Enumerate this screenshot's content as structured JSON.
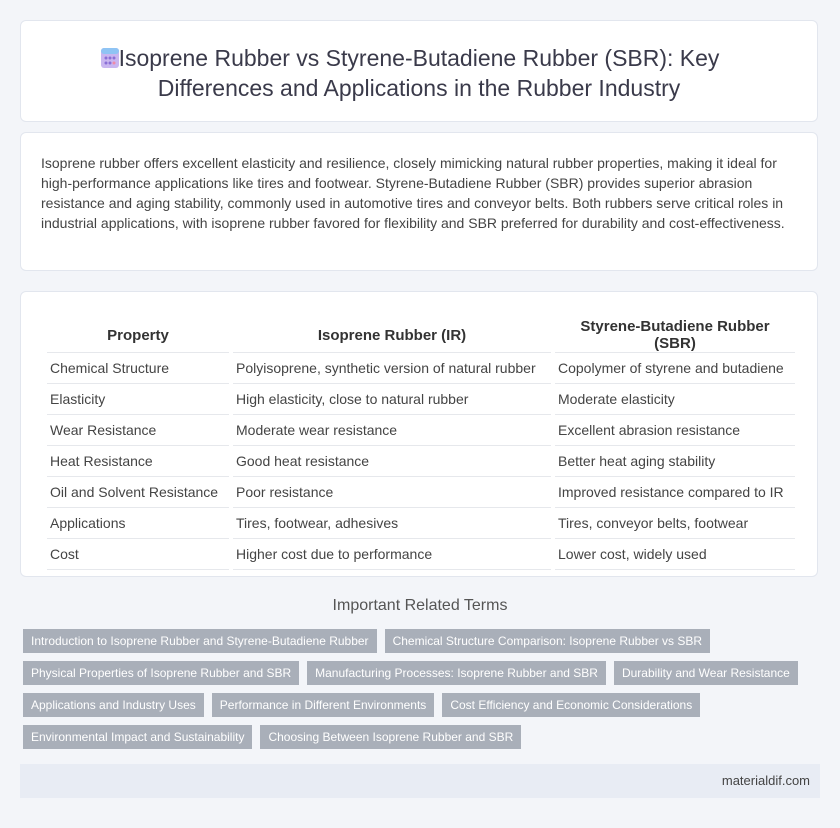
{
  "header": {
    "title": "Isoprene Rubber vs Styrene-Butadiene Rubber (SBR): Key Differences and Applications in the Rubber Industry",
    "icon": "calculator-icon"
  },
  "intro": "Isoprene rubber offers excellent elasticity and resilience, closely mimicking natural rubber properties, making it ideal for high-performance applications like tires and footwear. Styrene-Butadiene Rubber (SBR) provides superior abrasion resistance and aging stability, commonly used in automotive tires and conveyor belts. Both rubbers serve critical roles in industrial applications, with isoprene rubber favored for flexibility and SBR preferred for durability and cost-effectiveness.",
  "table": {
    "headers": [
      "Property",
      "Isoprene Rubber (IR)",
      "Styrene-Butadiene Rubber (SBR)"
    ],
    "rows": [
      [
        "Chemical Structure",
        "Polyisoprene, synthetic version of natural rubber",
        "Copolymer of styrene and butadiene"
      ],
      [
        "Elasticity",
        "High elasticity, close to natural rubber",
        "Moderate elasticity"
      ],
      [
        "Wear Resistance",
        "Moderate wear resistance",
        "Excellent abrasion resistance"
      ],
      [
        "Heat Resistance",
        "Good heat resistance",
        "Better heat aging stability"
      ],
      [
        "Oil and Solvent Resistance",
        "Poor resistance",
        "Improved resistance compared to IR"
      ],
      [
        "Applications",
        "Tires, footwear, adhesives",
        "Tires, conveyor belts, footwear"
      ],
      [
        "Cost",
        "Higher cost due to performance",
        "Lower cost, widely used"
      ]
    ]
  },
  "related": {
    "title": "Important Related Terms",
    "tags": [
      "Introduction to Isoprene Rubber and Styrene-Butadiene Rubber",
      "Chemical Structure Comparison: Isoprene Rubber vs SBR",
      "Physical Properties of Isoprene Rubber and SBR",
      "Manufacturing Processes: Isoprene Rubber and SBR",
      "Durability and Wear Resistance",
      "Applications and Industry Uses",
      "Performance in Different Environments",
      "Cost Efficiency and Economic Considerations",
      "Environmental Impact and Sustainability",
      "Choosing Between Isoprene Rubber and SBR"
    ]
  },
  "footer": {
    "site": "materialdif.com"
  },
  "colors": {
    "tag_bg": "#a9afb9",
    "page_bg": "#f3f5f9",
    "footer_bg": "#e8ecf4"
  }
}
